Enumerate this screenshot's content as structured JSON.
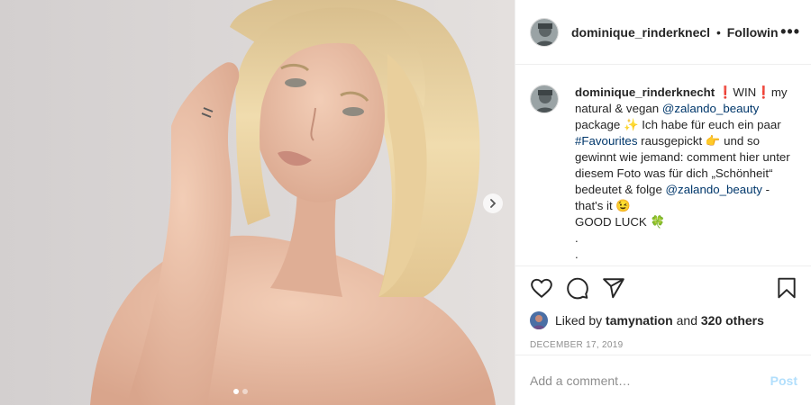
{
  "post": {
    "username": "dominique_rinderknecht",
    "username_truncated": "dominique_rinderknecl",
    "separator": "•",
    "follow_status": "Following",
    "more_glyph": "•••",
    "next_glyph": "›"
  },
  "caption": {
    "username": "dominique_rinderknecht",
    "parts": [
      {
        "text": " "
      },
      {
        "text": "❗",
        "emoji": "red-exclamation"
      },
      {
        "text": "WIN"
      },
      {
        "text": "❗",
        "emoji": "red-exclamation"
      },
      {
        "text": "my natural & vegan "
      },
      {
        "text": "@zalando_beauty",
        "link": true
      },
      {
        "text": " package "
      },
      {
        "text": "✨",
        "emoji": "sparkles"
      },
      {
        "text": " Ich habe für euch ein paar "
      },
      {
        "text": "#Favourites",
        "link": true
      },
      {
        "text": " rausgepickt "
      },
      {
        "text": "👉",
        "emoji": "pointing-hand"
      },
      {
        "text": " und so gewinnt wie jemand: comment hier unter diesem Foto was für dich „Schönheit“ bedeutet & folge "
      },
      {
        "text": "@zalando_beauty",
        "link": true
      },
      {
        "text": " - that's it "
      },
      {
        "text": "😉",
        "emoji": "winking-face"
      },
      {
        "text": "\nGOOD LUCK "
      },
      {
        "text": "🍀",
        "emoji": "four-leaf-clover"
      },
      {
        "text": "\n.\n."
      }
    ]
  },
  "likes": {
    "prefix": "Liked by ",
    "user": "tamynation",
    "suffix": " and ",
    "others": "320 others"
  },
  "date": "DECEMBER 17, 2019",
  "comment": {
    "placeholder": "Add a comment…",
    "post_label": "Post"
  },
  "carousel": {
    "count": 2,
    "active_index": 0
  },
  "colors": {
    "link": "#00376b",
    "post_disabled": "#b2dffc",
    "photo_background": "#d9d4d3",
    "hair": "#e8d3a3",
    "skin": "#e9c0a8"
  }
}
